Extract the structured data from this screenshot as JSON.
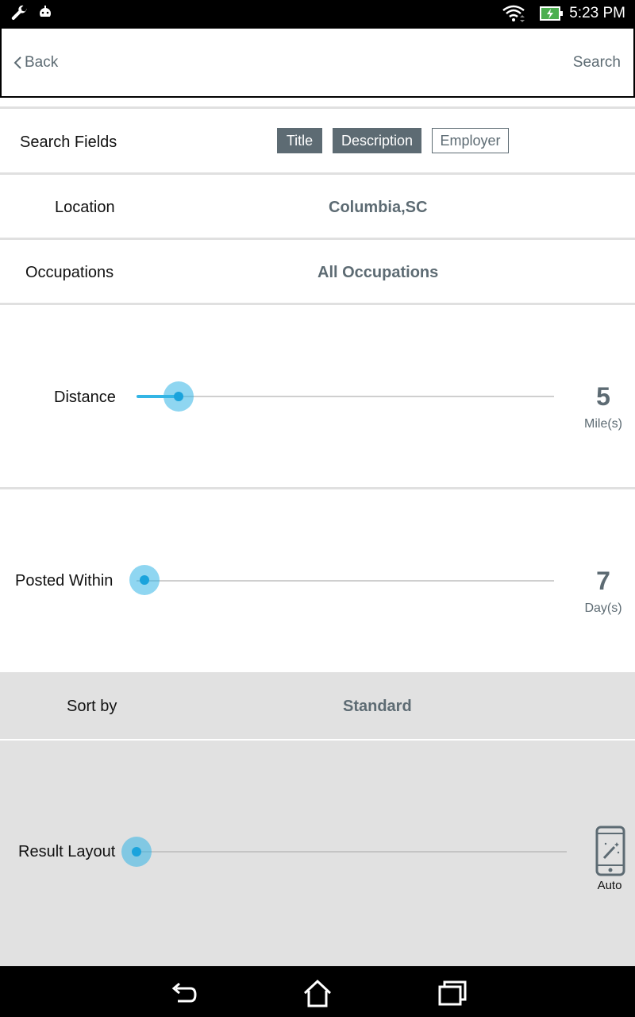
{
  "status_bar": {
    "time": "5:23 PM",
    "icons": [
      "wrench-icon",
      "android-debug-icon",
      "wifi-icon",
      "battery-charging-icon"
    ]
  },
  "header": {
    "back_label": "Back",
    "search_label": "Search"
  },
  "search_fields": {
    "label": "Search Fields",
    "chips": [
      {
        "label": "Title",
        "selected": true
      },
      {
        "label": "Description",
        "selected": true
      },
      {
        "label": "Employer",
        "selected": false
      }
    ]
  },
  "location": {
    "label": "Location",
    "value": "Columbia,SC"
  },
  "occupations": {
    "label": "Occupations",
    "value": "All Occupations"
  },
  "distance": {
    "label": "Distance",
    "value": "5",
    "unit": "Mile(s)",
    "level": 0.1
  },
  "posted_within": {
    "label": "Posted Within",
    "value": "7",
    "unit": "Day(s)",
    "level": 0.0
  },
  "sort_by": {
    "label": "Sort by",
    "value": "Standard"
  },
  "result_layout": {
    "label": "Result Layout",
    "value": "Auto",
    "icon": "phone-auto-layout-icon",
    "level": 0.0
  },
  "colors": {
    "accent": "#33b5e5",
    "slate": "#5d6b73",
    "gray_bg": "#e1e1e1"
  }
}
